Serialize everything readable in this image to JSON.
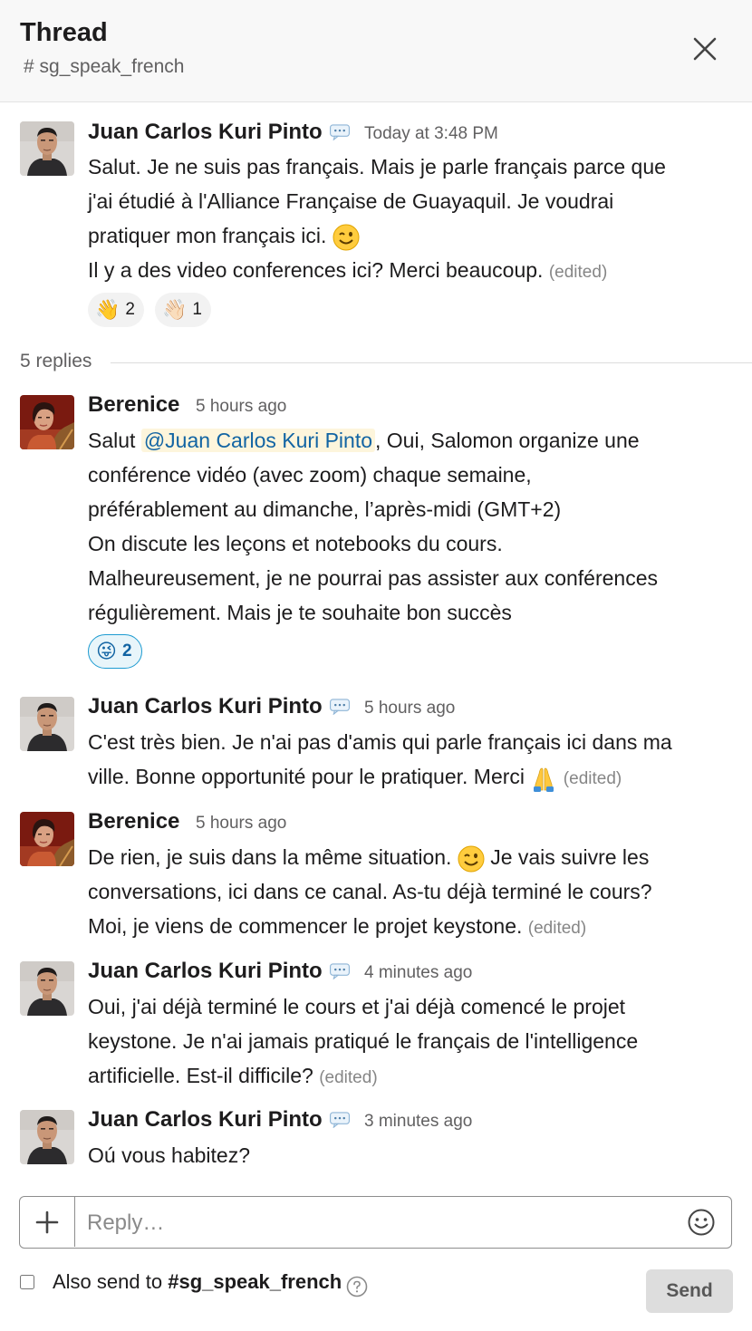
{
  "header": {
    "title": "Thread",
    "channel_prefix": "#",
    "channel": "sg_speak_french"
  },
  "original": {
    "author": "Juan Carlos Kuri Pinto",
    "time": "Today at 3:48 PM",
    "lines": [
      "Salut. Je ne suis pas français. Mais je parle français parce que",
      "j'ai étudié à l'Alliance Française de Guayaquil. Je voudrai",
      "pratiquer mon français ici.",
      "Il y a des video conferences ici? Merci beaucoup."
    ],
    "edited": "(edited)",
    "reactions": [
      {
        "emoji": "👋",
        "count": "2"
      },
      {
        "emoji": "👋🏻",
        "count": "1"
      }
    ]
  },
  "replies_label": "5 replies",
  "replies": [
    {
      "author": "Berenice",
      "time": "5 hours ago",
      "prefix": "Salut ",
      "mention": "@Juan Carlos Kuri Pinto",
      "suffix": ", Oui, Salomon organize une",
      "lines": [
        "conférence vidéo (avec zoom) chaque semaine,",
        "préférablement au dimanche, l’après-midi (GMT+2)",
        "On discute les leçons et notebooks du cours.",
        "Malheureusement, je ne pourrai pas assister aux conférences",
        "régulièrement. Mais je te souhaite bon  succès"
      ],
      "reaction": {
        "emoji": "😜",
        "count": "2"
      }
    },
    {
      "author": "Juan Carlos Kuri Pinto",
      "time": "5 hours ago",
      "lines": [
        "C'est très bien. Je n'ai pas d'amis qui parle français ici dans ma",
        "ville.  Bonne opportunité pour le pratiquer. Merci"
      ],
      "edited": "(edited)"
    },
    {
      "author": "Berenice",
      "time": "5 hours ago",
      "lines": [
        "De rien, je suis dans la même situation.",
        "Je vais suivre les",
        "conversations, ici dans ce canal. As-tu déjà terminé le cours?",
        "Moi, je viens de commencer le projet keystone."
      ],
      "edited": "(edited)"
    },
    {
      "author": "Juan Carlos Kuri Pinto",
      "time": "4 minutes ago",
      "lines": [
        "Oui, j'ai déjà terminé le cours et j'ai déjà comencé le projet",
        "keystone. Je n'ai jamais pratiqué le français de l'intelligence",
        "artificielle. Est-il difficile?"
      ],
      "edited": "(edited)"
    },
    {
      "author": "Juan Carlos Kuri Pinto",
      "time": "3 minutes ago",
      "lines": [
        "Oú vous habitez?"
      ]
    }
  ],
  "composer": {
    "placeholder": "Reply…"
  },
  "footer": {
    "also_send": "Also send to",
    "channel_prefix": "#",
    "channel": "sg_speak_french",
    "send": "Send"
  },
  "icons": {
    "close": "close-icon",
    "chat": "speech-bubble-icon",
    "plus": "plus-icon",
    "smile": "smiley-icon",
    "help": "question-circle-icon",
    "wink": "wink-emoji",
    "pray": "pray-emoji"
  },
  "colors": {
    "mention_text": "#1264a3",
    "mention_bg": "#fdf5dc",
    "reaction_active_border": "#1d9bd1",
    "send_bg": "#dddddd"
  }
}
